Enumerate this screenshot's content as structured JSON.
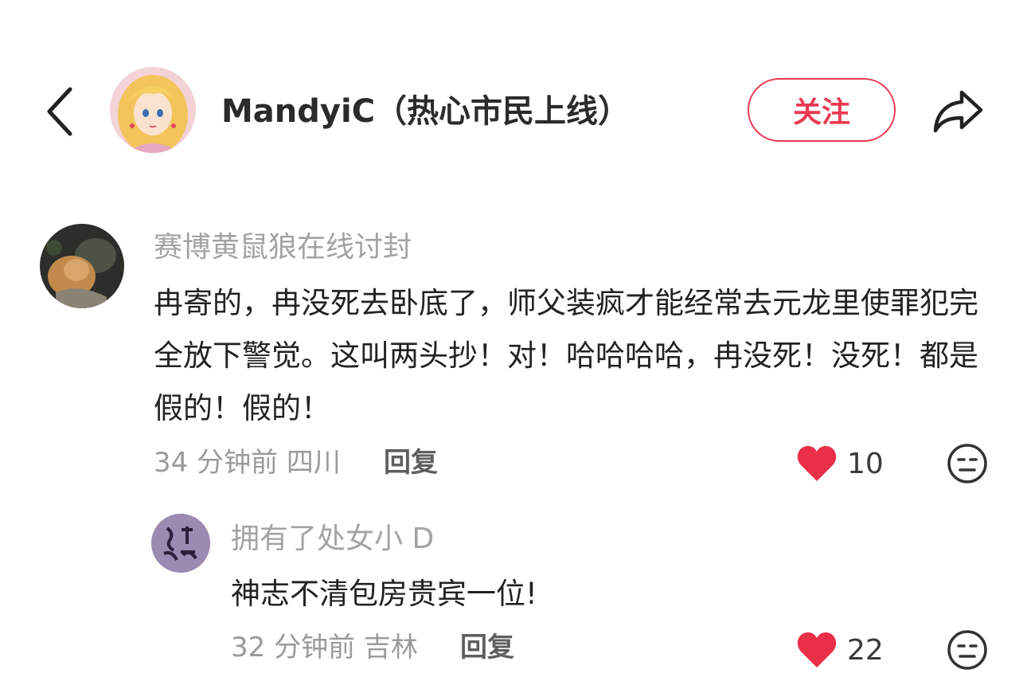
{
  "header": {
    "title": "MandyiC（热心市民上线）",
    "follow_label": "关注",
    "accent_color": "#ea3a52",
    "icons": [
      "chevron-left-icon",
      "share-arrow-icon"
    ]
  },
  "comments": [
    {
      "username": "赛博黄鼠狼在线讨封",
      "content": "冉寄的，冉没死去卧底了，师父装疯才能经常去元龙里使罪犯完全放下警觉。这叫两头抄！对！哈哈哈哈，冉没死！没死！都是假的！假的！",
      "meta": "34 分钟前 四川",
      "reply_label": "回复",
      "likes": "10",
      "liked": true
    }
  ],
  "replies": [
    {
      "username": "拥有了处女小 D",
      "content": "神志不清包房贵宾一位!",
      "meta": "32 分钟前 吉林",
      "reply_label": "回复",
      "likes": "22",
      "liked": true
    }
  ]
}
